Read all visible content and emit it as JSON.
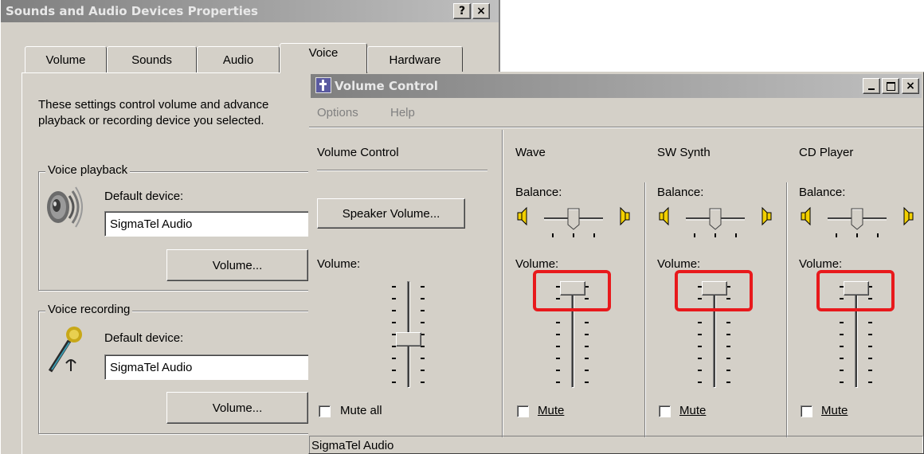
{
  "sound_dialog": {
    "title": "Sounds and Audio Devices Properties",
    "help_btn": "?",
    "close_btn": "×",
    "tabs": [
      "Volume",
      "Sounds",
      "Audio",
      "Voice",
      "Hardware"
    ],
    "active_tab": "Voice",
    "description_line1": "These settings control volume and advance",
    "description_line2": "playback or recording device you selected.",
    "playback": {
      "group_label": "Voice playback",
      "default_device_label": "Default device:",
      "device_value": "SigmaTel Audio",
      "volume_button": "Volume..."
    },
    "recording": {
      "group_label": "Voice recording",
      "default_device_label": "Default device:",
      "device_value": "SigmaTel Audio",
      "volume_button": "Volume..."
    }
  },
  "volume_control": {
    "title": "Volume Control",
    "menu": [
      "Options",
      "Help"
    ],
    "status_text": "SigmaTel Audio",
    "master": {
      "name": "Volume Control",
      "speaker_button": "Speaker Volume...",
      "volume_label": "Volume:",
      "mute_label": "Mute all",
      "volume_level": 0.45,
      "muted": false
    },
    "channels": [
      {
        "name": "Wave",
        "balance_label": "Balance:",
        "volume_label": "Volume:",
        "mute_label": "Mute",
        "volume_level": 1.0,
        "muted": false
      },
      {
        "name": "SW Synth",
        "balance_label": "Balance:",
        "volume_label": "Volume:",
        "mute_label": "Mute",
        "volume_level": 1.0,
        "muted": false
      },
      {
        "name": "CD Player",
        "balance_label": "Balance:",
        "volume_label": "Volume:",
        "mute_label": "Mute",
        "volume_level": 1.0,
        "muted": false
      }
    ],
    "highlight_color": "#e8191c"
  }
}
